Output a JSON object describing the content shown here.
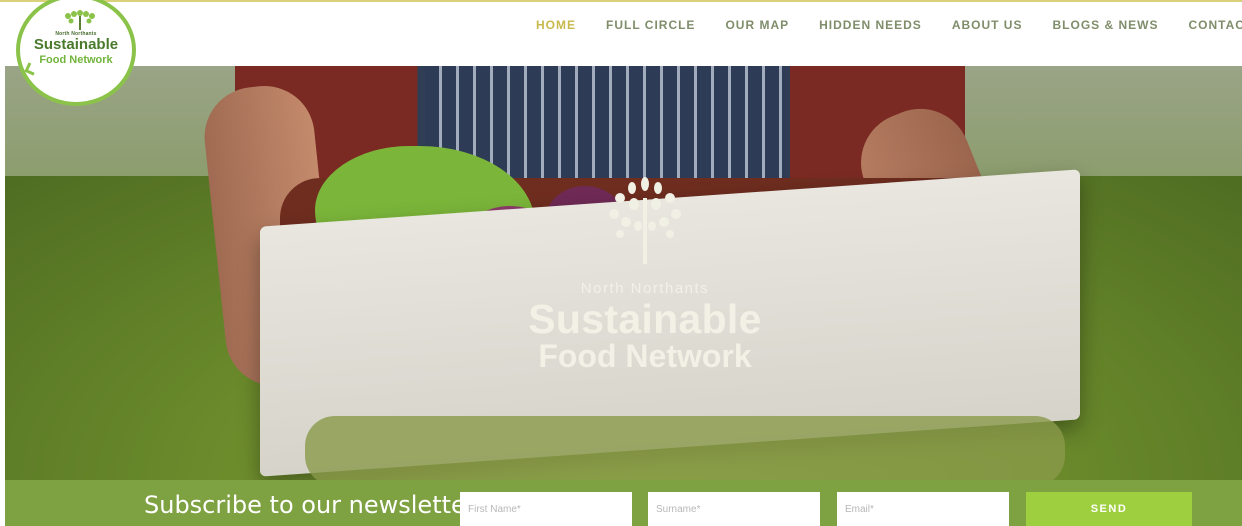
{
  "brand": {
    "small_text": "North Northants",
    "line1": "Sustainable",
    "line2": "Food Network"
  },
  "nav": {
    "items": [
      {
        "label": "HOME",
        "active": true
      },
      {
        "label": "FULL CIRCLE",
        "active": false
      },
      {
        "label": "OUR MAP",
        "active": false
      },
      {
        "label": "HIDDEN NEEDS",
        "active": false
      },
      {
        "label": "ABOUT US",
        "active": false
      },
      {
        "label": "BLOGS & NEWS",
        "active": false
      },
      {
        "label": "CONTACT US",
        "active": false
      }
    ],
    "active_color": "#c8b94c",
    "color": "#7f8d6b"
  },
  "hero": {
    "northants": "North Northants",
    "line1": "Sustainable",
    "line2": "Food Network"
  },
  "newsletter": {
    "title": "Subscribe to our newsletter",
    "first_name_placeholder": "First Name*",
    "surname_placeholder": "Surname*",
    "email_placeholder": "Email*",
    "send_label": "SEND",
    "bar_color": "#7ea142",
    "button_color": "#9ecf3f"
  }
}
